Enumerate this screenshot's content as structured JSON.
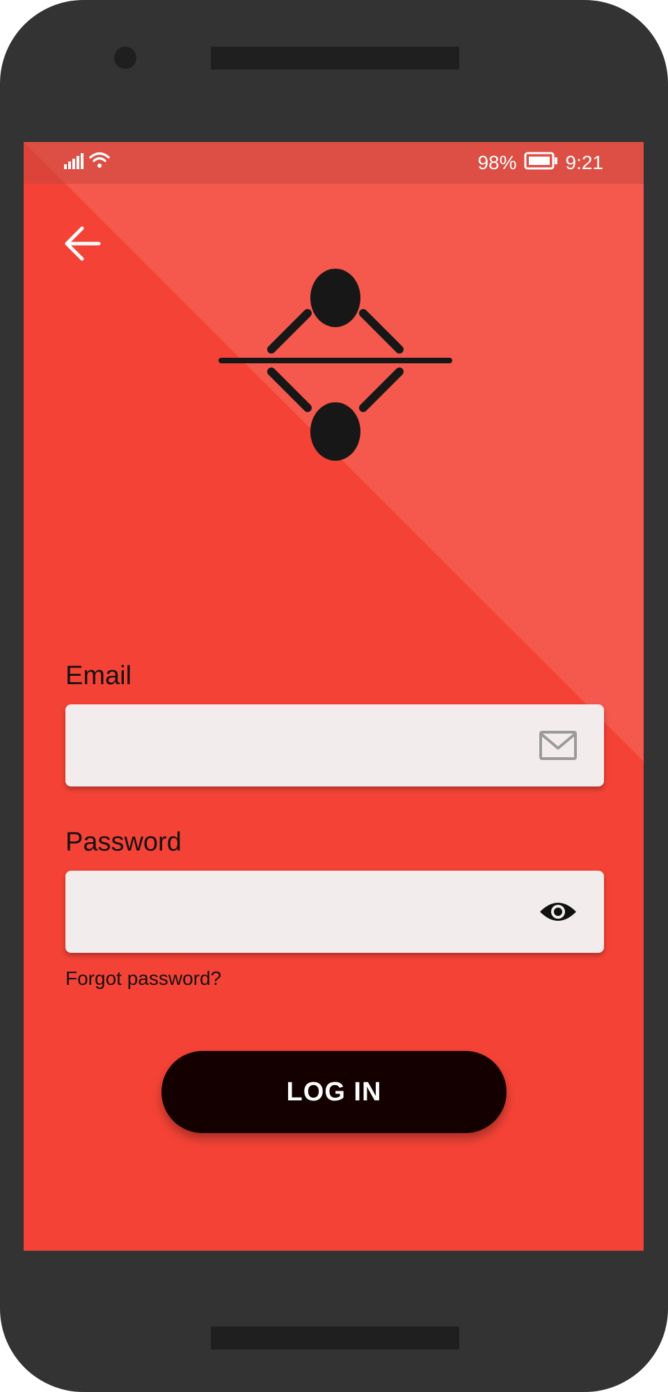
{
  "status_bar": {
    "battery_percent": "98%",
    "time": "9:21",
    "signal_icon": "cellular-signal-icon",
    "wifi_icon": "wifi-icon",
    "battery_icon": "battery-icon"
  },
  "header": {
    "back_icon": "arrow-left-icon"
  },
  "logo": {
    "icon": "app-logo-icon"
  },
  "form": {
    "email_label": "Email",
    "email_value": "",
    "email_placeholder": "",
    "email_icon": "envelope-icon",
    "password_label": "Password",
    "password_value": "",
    "password_placeholder": "",
    "password_icon": "eye-icon",
    "forgot_password": "Forgot password?",
    "login_button": "LOG IN"
  },
  "colors": {
    "background": "#f44336",
    "button": "#150000",
    "input": "#f3ecec",
    "device": "#333333"
  }
}
